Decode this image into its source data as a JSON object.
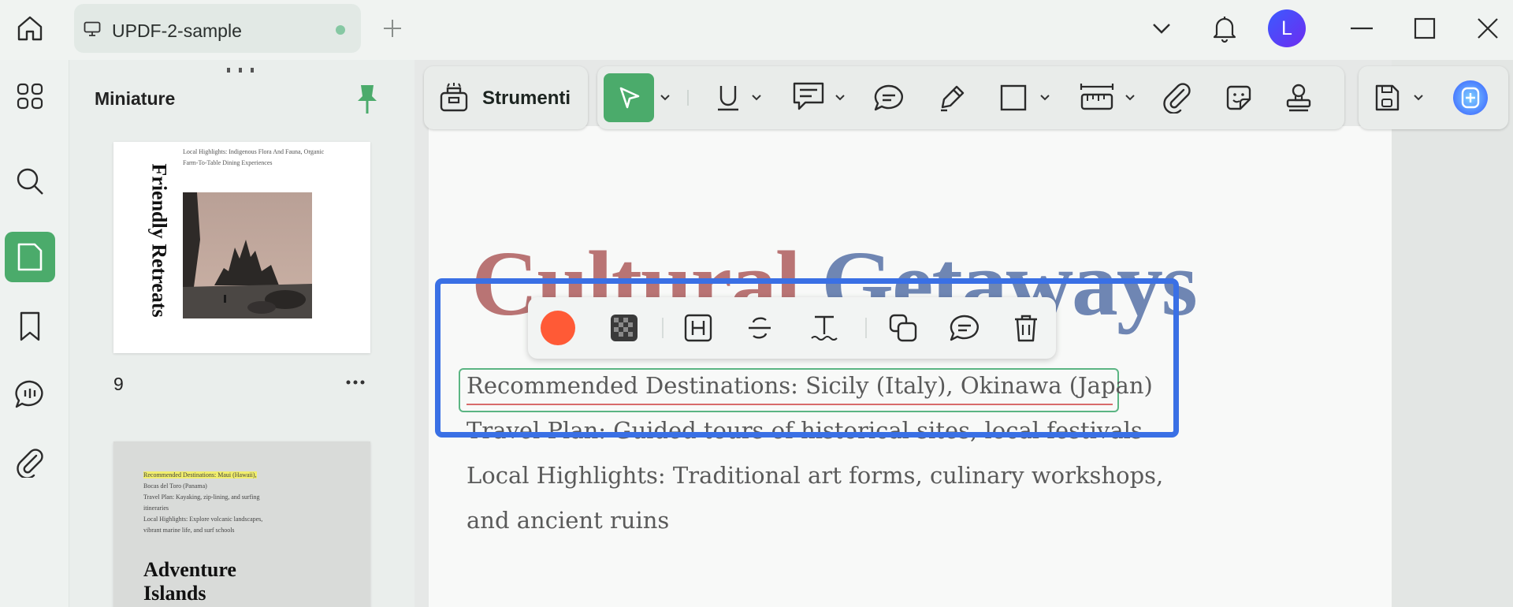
{
  "tab": {
    "title": "UPDF-2-sample"
  },
  "user": {
    "avatar_initial": "L"
  },
  "colors": {
    "accent": "#4bab6b",
    "selection_frame": "#3a70e5",
    "heading_word1": "#b97474",
    "heading_word2": "#6f86b3",
    "color_swatch": "#ff5a36"
  },
  "thumbnails": {
    "title": "Miniature",
    "page1": {
      "vertical_title": "Friendly Retreats",
      "lines": [
        "Local Highlights: Indigenous Flora And Fauna, Organic",
        "Farm-To-Table Dining Experiences"
      ],
      "number": "9"
    },
    "page2": {
      "lines": [
        "Recommended Destinations: Maui (Hawaii),",
        "Bocas del Toro (Panama)",
        "Travel Plan: Kayaking, zip-lining, and surfing",
        "itineraries",
        "Local Highlights: Explore volcanic landscapes,",
        "vibrant marine life, and surf schools"
      ],
      "title_line1": "Adventure",
      "title_line2": "Islands"
    }
  },
  "toolbar": {
    "tools_label": "Strumenti"
  },
  "document": {
    "heading_word1": "Cultural",
    "heading_word2": "Getaways",
    "lines": [
      "Recommended Destinations: Sicily (Italy), Okinawa (Japan)",
      "Travel Plan: Guided tours of historical sites, local festivals",
      "Local Highlights: Traditional art forms, culinary workshops,",
      "and ancient ruins"
    ]
  }
}
